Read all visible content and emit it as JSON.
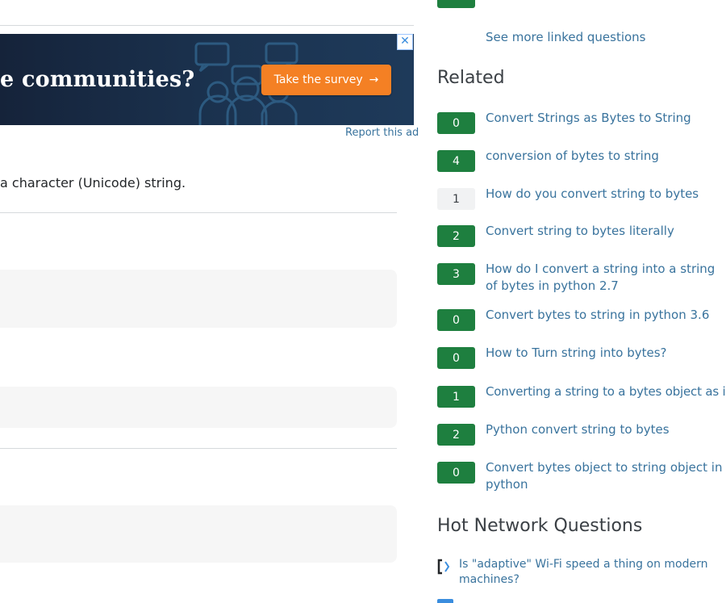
{
  "ad": {
    "headline": "e communities?",
    "cta_label": "Take the survey",
    "cta_arrow": "→",
    "close_glyph": "✕",
    "report_label": "Report this ad"
  },
  "question": {
    "body_fragment": "a character (Unicode) string."
  },
  "sidebar": {
    "see_more_label": "See more linked questions",
    "related_title": "Related",
    "related": [
      {
        "votes": "0",
        "title": "Convert Strings as Bytes to String"
      },
      {
        "votes": "4",
        "title": "conversion of bytes to string"
      },
      {
        "votes": "1",
        "title": "How do you convert string to bytes"
      },
      {
        "votes": "2",
        "title": "Convert string to bytes literally"
      },
      {
        "votes": "3",
        "title": "How do I convert a string into a string of bytes in python 2.7"
      },
      {
        "votes": "0",
        "title": "Convert bytes to string in python 3.6"
      },
      {
        "votes": "0",
        "title": "How to Turn string into bytes?"
      },
      {
        "votes": "1",
        "title": "Converting a string to a bytes object as is"
      },
      {
        "votes": "2",
        "title": "Python convert string to bytes"
      },
      {
        "votes": "0",
        "title": "Convert bytes object to string object in python"
      }
    ],
    "hnq_title": "Hot Network Questions",
    "hnq": [
      {
        "title": "Is \"adaptive\" Wi-Fi speed a thing on modern machines?",
        "icon": "stack-exchange-site-icon"
      }
    ]
  },
  "colors": {
    "accepted_green": "#1e7f3f",
    "link": "#39739d",
    "cta_orange": "#f48024"
  }
}
